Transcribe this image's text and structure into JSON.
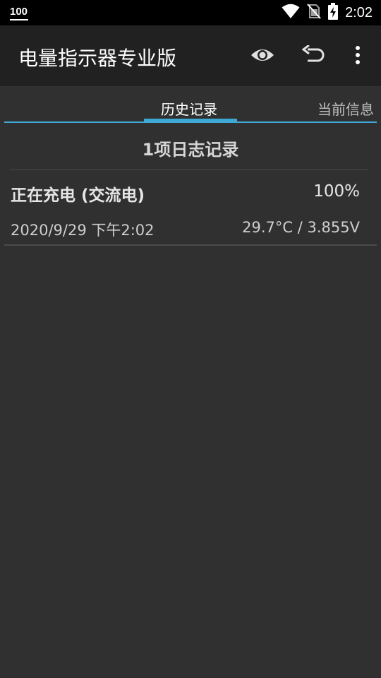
{
  "status_bar": {
    "battery_percent_text": "100",
    "time": "2:02",
    "icons": [
      "wifi-icon",
      "no-sim-icon",
      "battery-charging-icon"
    ]
  },
  "app_bar": {
    "title": "电量指示器专业版",
    "actions": [
      "eye-icon",
      "undo-icon",
      "more-vert-icon"
    ]
  },
  "tabs": [
    {
      "label": "历史记录",
      "selected": true
    },
    {
      "label": "当前信息",
      "selected": false
    }
  ],
  "log": {
    "count_text": "1项日志记录",
    "entries": [
      {
        "status": "正在充电 (交流电)",
        "level": "100%",
        "timestamp": "2020/9/29  下午2:02",
        "temp_voltage": "29.7°C / 3.855V"
      }
    ]
  },
  "colors": {
    "background": "#303030",
    "app_bar": "#212121",
    "accent": "#3fa9d6"
  }
}
